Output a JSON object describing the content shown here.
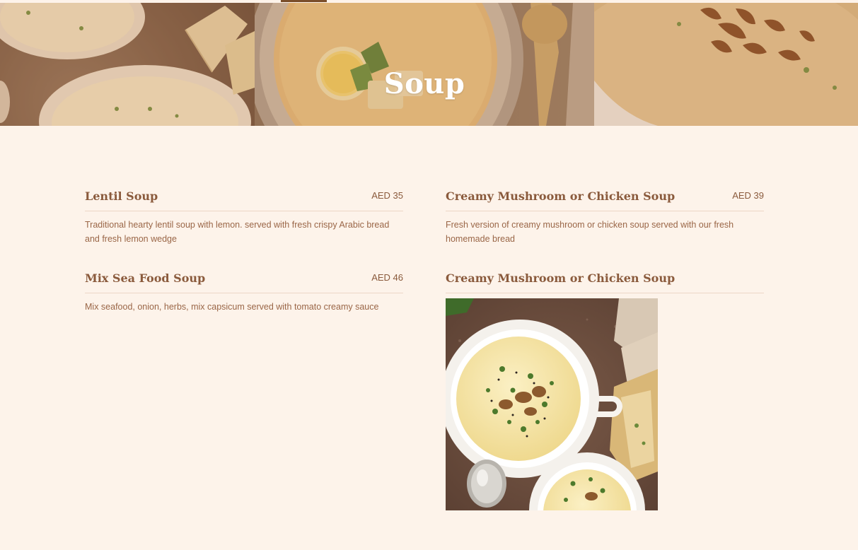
{
  "page": {
    "title": "Soup"
  },
  "menu": {
    "items": [
      {
        "name": "Lentil Soup",
        "price": "AED 35",
        "description": "Traditional hearty lentil soup with lemon. served with fresh crispy Arabic bread and fresh lemon wedge"
      },
      {
        "name": "Creamy Mushroom or Chicken Soup",
        "price": "AED 39",
        "description": "Fresh version of creamy mushroom or chicken soup served with our fresh homemade bread"
      },
      {
        "name": "Mix Sea Food Soup",
        "price": "AED 46",
        "description": "Mix seafood, onion, herbs, mix capsicum served with tomato creamy sauce"
      },
      {
        "name": "Creamy Mushroom or Chicken Soup",
        "price": "",
        "description": ""
      }
    ]
  },
  "colors": {
    "background": "#fdf3ea",
    "heading_text": "#8a5a3c",
    "body_text": "#9a6647",
    "divider": "#ecd6c6",
    "hero_title": "#ffffff"
  },
  "icons": {
    "photo": "soup-bowls-photo"
  }
}
